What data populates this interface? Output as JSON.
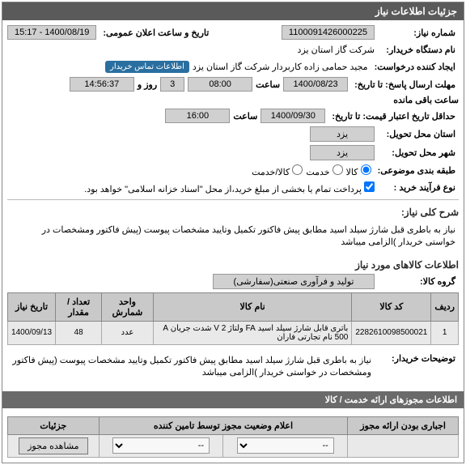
{
  "panel_title": "جزئیات اطلاعات نیاز",
  "fields": {
    "need_number_label": "شماره نیاز:",
    "need_number": "1100091426000225",
    "announce_label": "تاریخ و ساعت اعلان عمومی:",
    "announce_value": "1400/08/19 - 15:17",
    "buyer_org_label": "نام دستگاه خریدار:",
    "buyer_org": "شرکت گاز استان یزد",
    "requester_label": "ایجاد کننده درخواست:",
    "requester": "مجید حمامی زاده کاربردار شرکت گاز استان یزد",
    "contact_badge": "اطلاعات تماس خریدار",
    "deadline_label": "مهلت ارسال پاسخ: تا تاریخ:",
    "deadline_date": "1400/08/23",
    "time_label": "ساعت",
    "deadline_time": "08:00",
    "remaining_days": "3",
    "remaining_days_label": "روز و",
    "remaining_time": "14:56:37",
    "remaining_suffix": "ساعت باقی مانده",
    "min_validity_label": "حداقل تاریخ اعتبار قیمت: تا تاریخ:",
    "min_validity_date": "1400/09/30",
    "min_validity_time": "16:00",
    "delivery_province_label": "استان محل تحویل:",
    "delivery_province": "یزد",
    "delivery_city_label": "شهر محل تحویل:",
    "delivery_city": "یزد",
    "category_label": "طبقه بندی موضوعی:",
    "category_goods": "کالا",
    "category_service": "خدمت",
    "category_both": "کالا/خدمت",
    "purchase_type_label": "نوع فرآیند خرید :",
    "purchase_type_text": "پرداخت تمام یا بخشی از مبلغ خرید،از محل \"اسناد خزانه اسلامی\" خواهد بود."
  },
  "sections": {
    "need_desc_title": "شرح کلی نیاز:",
    "need_desc": "نیاز به باطری قبل شارژ سیلد اسید مطابق پیش فاکتور تکمیل وتایید مشخصات پیوست (پیش فاکتور ومشخصات در خواستی خریدار )الزامی میباشد",
    "goods_title": "اطلاعات کالاهای مورد نیاز",
    "group_label": "گروه کالا:",
    "group_value": "تولید و فرآوری صنعتی(سفارشی)",
    "buyer_notes_label": "توضیحات خریدار:",
    "buyer_notes": "نیاز به باطری قبل شارژ سیلد اسید مطابق پیش فاکتور تکمیل وتایید مشخصات پیوست (پیش فاکتور ومشخصات در خواستی خریدار )الزامی میباشد"
  },
  "table": {
    "headers": {
      "row": "ردیف",
      "code": "کد کالا",
      "name": "نام کالا",
      "unit": "واحد شمارش",
      "qty": "تعداد / مقدار",
      "date": "تاریخ نیاز"
    },
    "rows": [
      {
        "idx": "1",
        "code": "2282610098500021",
        "name": "باتری قابل شارژ سیلد اسید FA ولتاژ V 2 شدت جریان A 500 نام تجارتی فاران",
        "unit": "عدد",
        "qty": "48",
        "date": "1400/09/13"
      }
    ]
  },
  "licenses": {
    "header": "اطلاعات مجوزهای ارائه خدمت / کالا",
    "sub_header": "اعلام وضعیت مجوز توسط تامین کننده",
    "mandatory_col": "اجباری بودن ارائه مجوز",
    "details_col": "جزئیات",
    "select_placeholder": "--",
    "view_btn": "مشاهده مجوز"
  }
}
